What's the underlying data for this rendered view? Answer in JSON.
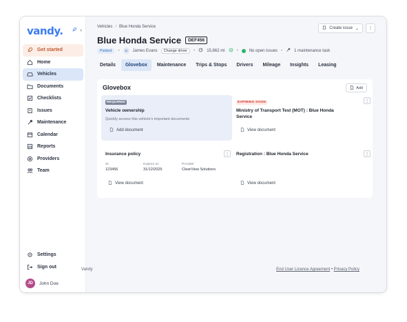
{
  "sidebar": {
    "logo": "vandy.",
    "items": [
      {
        "label": "Get started",
        "icon": "rocket-icon",
        "state": "highlight"
      },
      {
        "label": "Home",
        "icon": "home-icon"
      },
      {
        "label": "Vehicles",
        "icon": "car-icon",
        "state": "active"
      },
      {
        "label": "Documents",
        "icon": "folder-icon"
      },
      {
        "label": "Checklists",
        "icon": "checklist-icon"
      },
      {
        "label": "Issues",
        "icon": "issue-icon"
      },
      {
        "label": "Maintenance",
        "icon": "wrench-icon"
      },
      {
        "label": "Calendar",
        "icon": "calendar-icon"
      },
      {
        "label": "Reports",
        "icon": "reports-icon"
      },
      {
        "label": "Providers",
        "icon": "providers-icon"
      },
      {
        "label": "Team",
        "icon": "team-icon"
      }
    ],
    "bottom_items": [
      {
        "label": "Settings",
        "icon": "gear-icon"
      },
      {
        "label": "Sign out",
        "icon": "signout-icon"
      }
    ],
    "user": {
      "initials": "JD",
      "name": "John Doe"
    }
  },
  "breadcrumb": {
    "root": "Vehicles",
    "sep": "/",
    "current": "Blue Honda Service"
  },
  "header": {
    "create_issue": "Create issue",
    "title": "Blue Honda Service",
    "plate": "DEF456",
    "status": "Parked",
    "driver_initials": "JE",
    "driver": "James Evans",
    "change_driver": "Change driver",
    "mileage": "15,862 mi",
    "open_issues": "No open issues",
    "maintenance": "1 maintenance task"
  },
  "tabs": [
    "Details",
    "Glovebox",
    "Maintenance",
    "Trips & Stops",
    "Drivers",
    "Mileage",
    "Insights",
    "Leasing"
  ],
  "active_tab": "Glovebox",
  "glovebox": {
    "title": "Glovebox",
    "add_label": "Add",
    "cards": {
      "ownership": {
        "badge": "REQUIRED",
        "title": "Vehicle ownership",
        "subtitle": "Quickly access this vehicle's important documents",
        "action": "Add document"
      },
      "mot": {
        "badge": "EXPIRING SOON",
        "title": "Ministry of Transport Test (MOT) : Blue Honda Service",
        "action": "View document"
      },
      "insurance": {
        "title": "Insurance policy",
        "fields": [
          {
            "label": "ID",
            "value": "123456"
          },
          {
            "label": "Expires on",
            "value": "31/12/2025"
          },
          {
            "label": "Provider",
            "value": "ClearView Solutions"
          }
        ],
        "action": "View document"
      },
      "registration": {
        "title": "Registration : Blue Honda Service",
        "action": "View document"
      }
    }
  },
  "footer": {
    "brand": "Vandy",
    "eula": "End User Licence Agreement",
    "sep": "•",
    "privacy": "Privacy Policy"
  }
}
